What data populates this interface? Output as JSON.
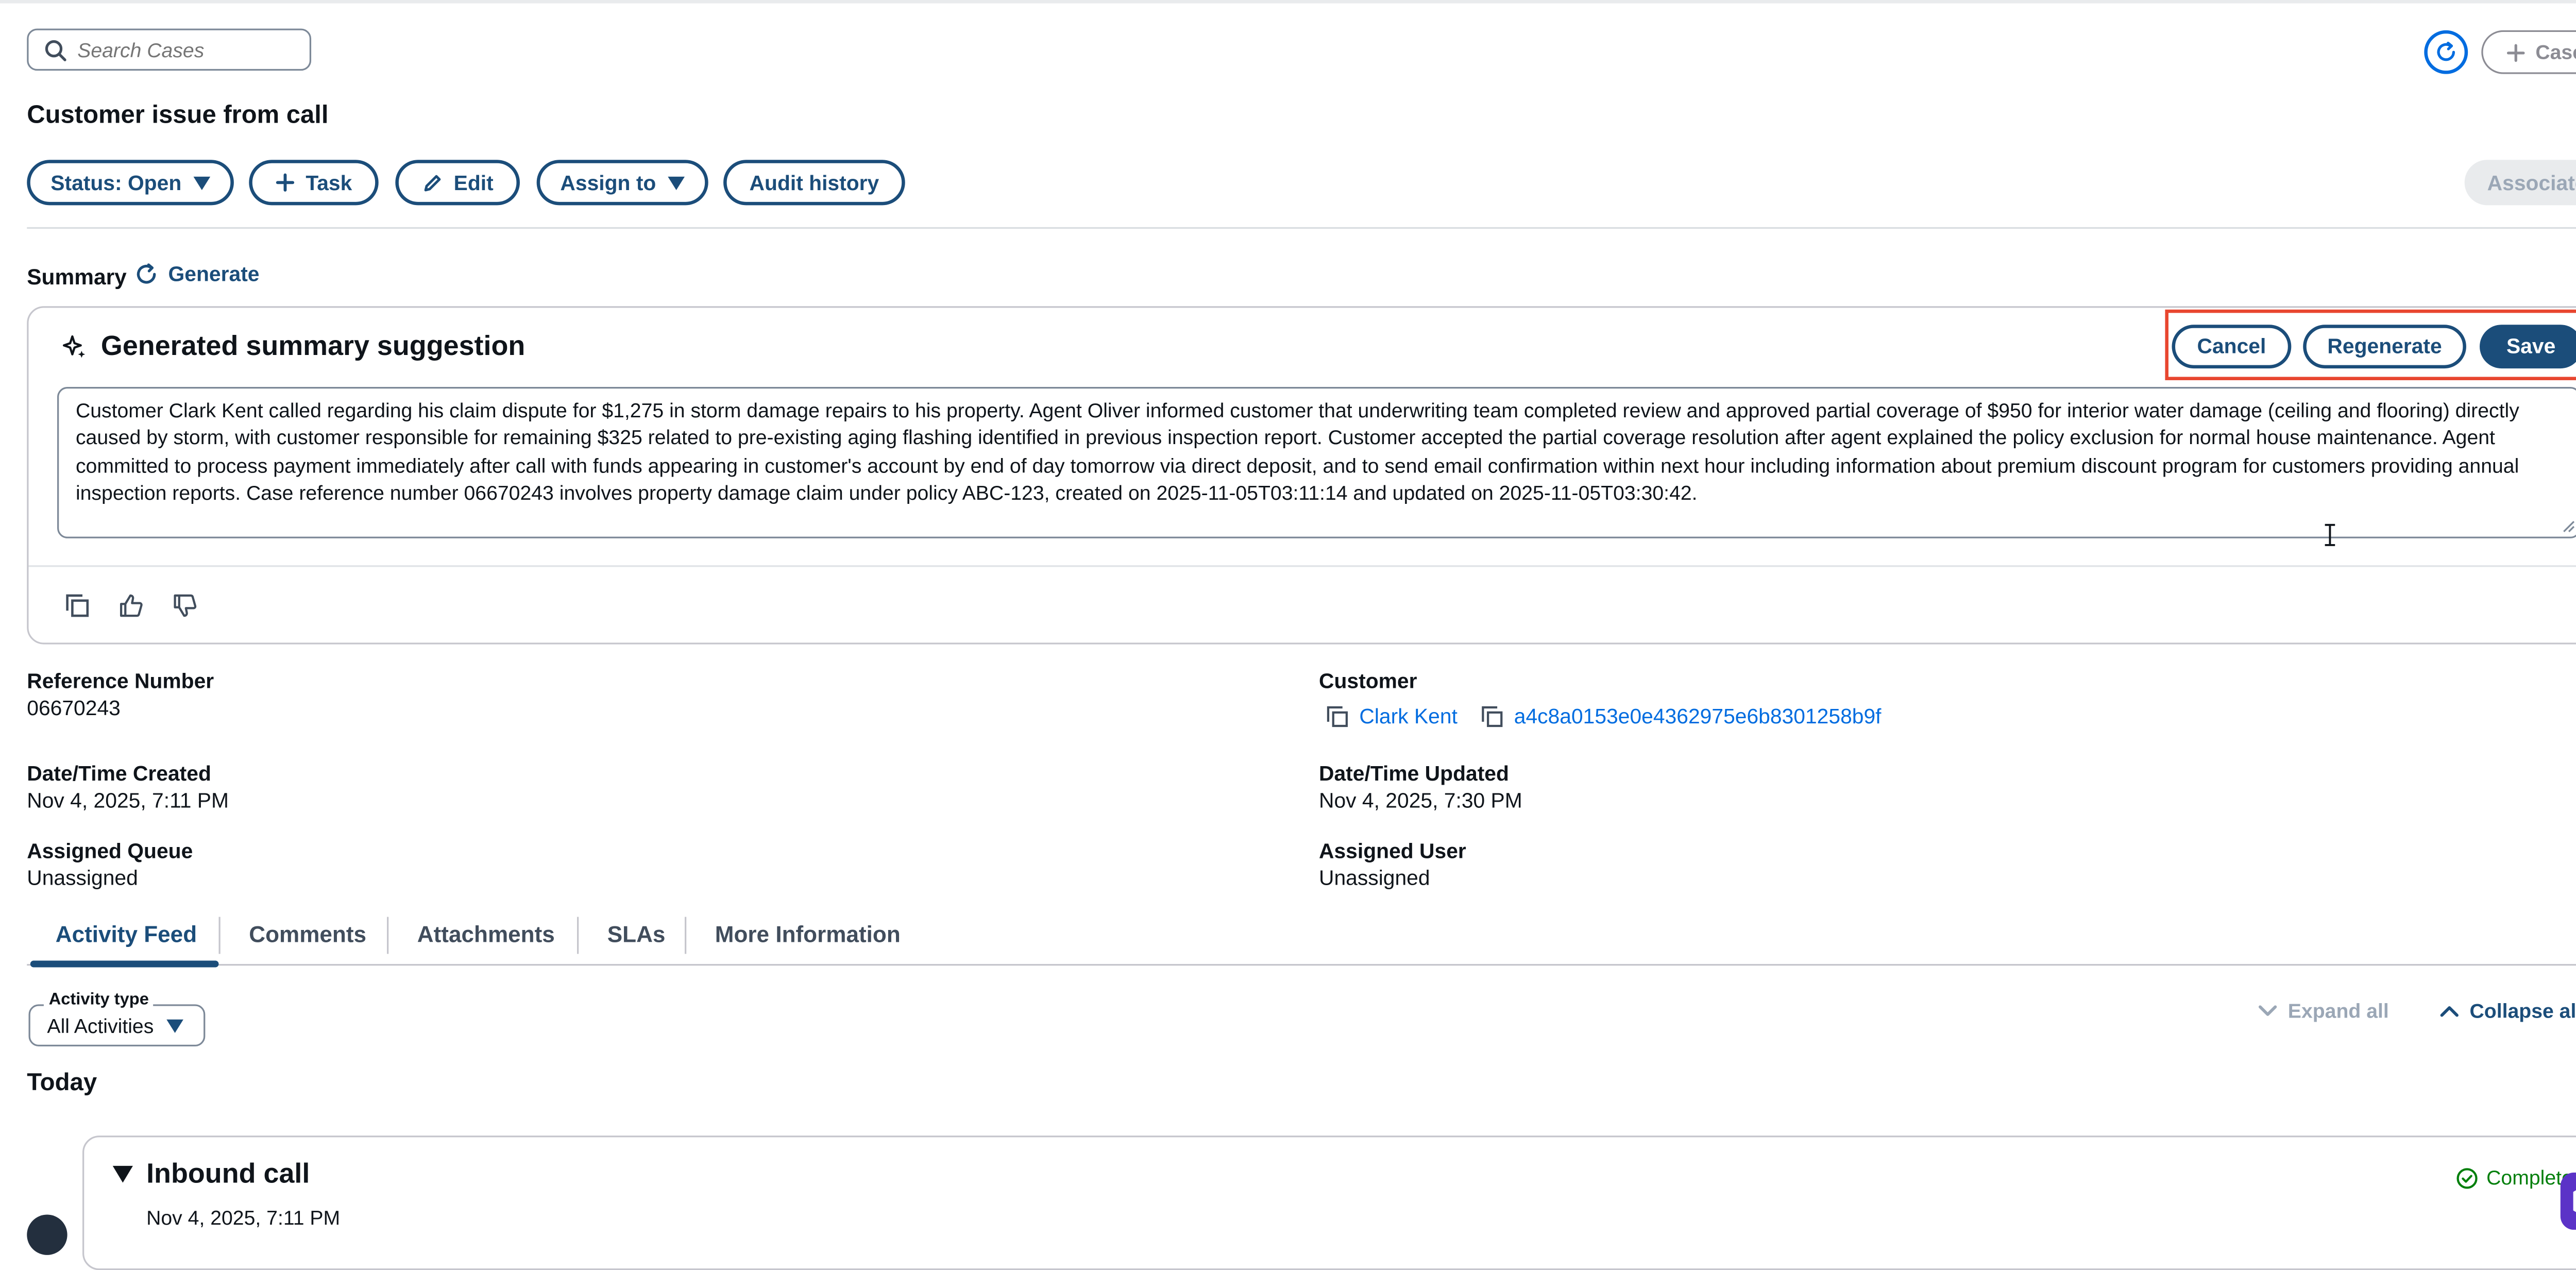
{
  "search": {
    "placeholder": "Search Cases"
  },
  "header": {
    "case_button": "Case",
    "title": "Customer issue from call"
  },
  "actions": {
    "status": "Status: Open",
    "task": "Task",
    "edit": "Edit",
    "assign": "Assign to",
    "audit": "Audit history",
    "associate": "Associate"
  },
  "summary": {
    "label": "Summary",
    "generate": "Generate",
    "card_title": "Generated summary suggestion",
    "cancel": "Cancel",
    "regenerate": "Regenerate",
    "save": "Save",
    "text": "Customer Clark Kent called regarding his claim dispute for $1,275 in storm damage repairs to his property. Agent Oliver informed customer that underwriting team completed review and approved partial coverage of $950 for interior water damage (ceiling and flooring) directly caused by storm, with customer responsible for remaining $325 related to pre-existing aging flashing identified in previous inspection report. Customer accepted the partial coverage resolution after agent explained the policy exclusion for normal house maintenance. Agent committed to process payment immediately after call with funds appearing in customer's account by end of day tomorrow via direct deposit, and to send email confirmation within next hour including information about premium discount program for customers providing annual inspection reports. Case reference number 06670243 involves property damage claim under policy ABC-123, created on 2025-11-05T03:11:14 and updated on 2025-11-05T03:30:42."
  },
  "fields": {
    "reference_label": "Reference Number",
    "reference_value": "06670243",
    "customer_label": "Customer",
    "customer_name": "Clark Kent",
    "customer_id": "a4c8a0153e0e4362975e6b8301258b9f",
    "created_label": "Date/Time Created",
    "created_value": "Nov 4, 2025, 7:11 PM",
    "updated_label": "Date/Time Updated",
    "updated_value": "Nov 4, 2025, 7:30 PM",
    "queue_label": "Assigned Queue",
    "queue_value": "Unassigned",
    "user_label": "Assigned User",
    "user_value": "Unassigned"
  },
  "tabs": [
    "Activity Feed",
    "Comments",
    "Attachments",
    "SLAs",
    "More Information"
  ],
  "activity": {
    "type_label": "Activity type",
    "type_value": "All Activities",
    "expand_all": "Expand all",
    "collapse_all": "Collapse all",
    "today": "Today",
    "item_title": "Inbound call",
    "item_date": "Nov 4, 2025, 7:11 PM",
    "item_status": "Completed"
  },
  "colors": {
    "primary": "#1b4d7a",
    "link": "#006ce0",
    "highlight": "#e8462f",
    "success": "#037f0c"
  }
}
